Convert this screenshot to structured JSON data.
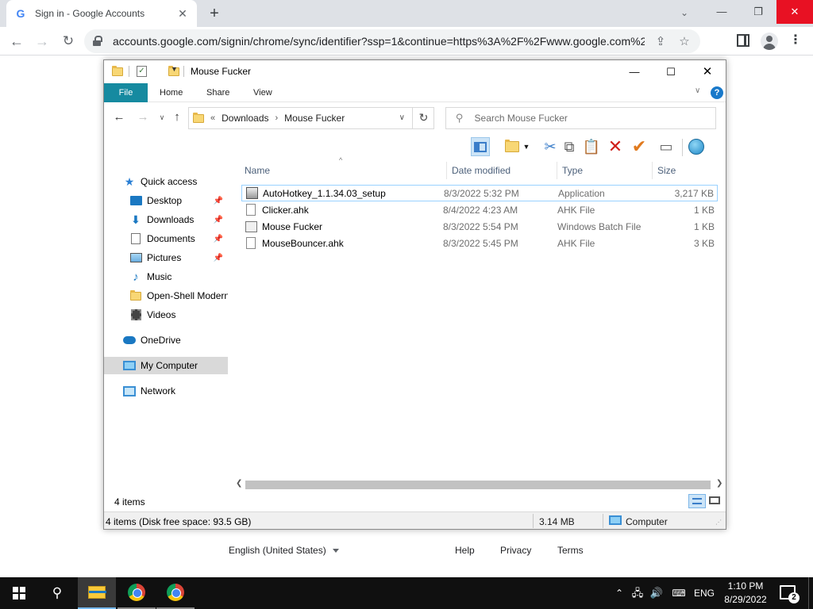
{
  "browser": {
    "tab_title": "Sign in - Google Accounts",
    "favicon": "G",
    "url": "accounts.google.com/signin/chrome/sync/identifier?ssp=1&continue=https%3A%2F%2Fwww.google.com%2F&..."
  },
  "google_footer": {
    "language": "English (United States)",
    "help": "Help",
    "privacy": "Privacy",
    "terms": "Terms"
  },
  "explorer": {
    "title": "Mouse Fucker",
    "ribbon_tabs": [
      "File",
      "Home",
      "Share",
      "View"
    ],
    "breadcrumb": {
      "prefix": "«",
      "items": [
        "Downloads",
        "Mouse Fucker"
      ]
    },
    "search_placeholder": "Search Mouse Fucker",
    "nav": {
      "quick_access": "Quick access",
      "quick_items": [
        "Desktop",
        "Downloads",
        "Documents",
        "Pictures",
        "Music",
        "Open-Shell Modern",
        "Videos"
      ],
      "onedrive": "OneDrive",
      "my_computer": "My Computer",
      "network": "Network"
    },
    "columns": {
      "name": "Name",
      "date": "Date modified",
      "type": "Type",
      "size": "Size"
    },
    "files": [
      {
        "name": "AutoHotkey_1.1.34.03_setup",
        "date": "8/3/2022 5:32 PM",
        "type": "Application",
        "size": "3,217 KB",
        "icon": "application-icon"
      },
      {
        "name": "Clicker.ahk",
        "date": "8/4/2022 4:23 AM",
        "type": "AHK File",
        "size": "1 KB",
        "icon": "ahk-file-icon"
      },
      {
        "name": "Mouse Fucker",
        "date": "8/3/2022 5:54 PM",
        "type": "Windows Batch File",
        "size": "1 KB",
        "icon": "batch-file-icon"
      },
      {
        "name": "MouseBouncer.ahk",
        "date": "8/3/2022 5:45 PM",
        "type": "AHK File",
        "size": "3 KB",
        "icon": "ahk-file-icon"
      }
    ],
    "item_count": "4 items",
    "status": {
      "disk": "4 items (Disk free space: 93.5 GB)",
      "size": "3.14 MB",
      "location": "Computer"
    }
  },
  "taskbar": {
    "language": "ENG",
    "time": "1:10 PM",
    "date": "8/29/2022",
    "notification_count": "2"
  }
}
